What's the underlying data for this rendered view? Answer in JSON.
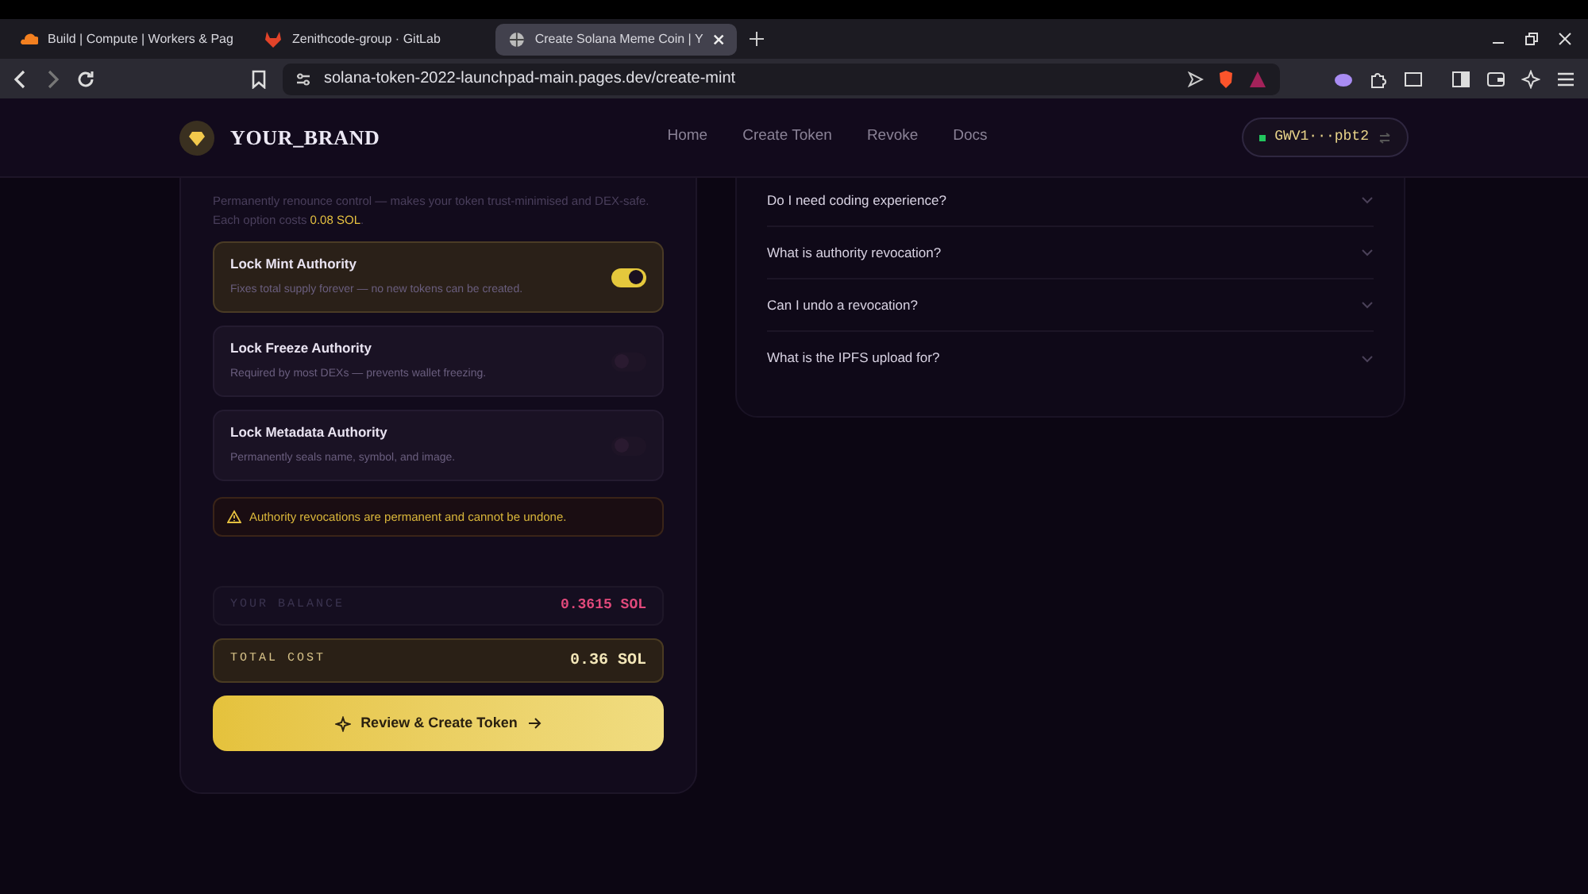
{
  "browser": {
    "tabs": [
      {
        "title": "Build | Compute | Workers & Pag",
        "selected": false,
        "kind": "cloud"
      },
      {
        "title": "Zenithcode-group · GitLab",
        "selected": false,
        "kind": "fox"
      },
      {
        "title": "Create Solana Meme Coin | Y",
        "selected": true,
        "kind": "globe"
      }
    ],
    "url": "solana-token-2022-launchpad-main.pages.dev/create-mint"
  },
  "header": {
    "brand": "YOUR_BRAND",
    "nav": [
      "Home",
      "Create Token",
      "Revoke",
      "Docs"
    ],
    "wallet": "GWV1···pbt2"
  },
  "lock": {
    "description": "Permanently renounce control — makes your token trust-minimised and DEX-safe. Each option costs **0.08 SOL**.",
    "options": [
      {
        "title": "Lock Mint Authority",
        "subtitle": "Fixes total supply forever — no new tokens can be created.",
        "on": true
      },
      {
        "title": "Lock Freeze Authority",
        "subtitle": "Required by most DEXs — prevents wallet freezing.",
        "on": false
      },
      {
        "title": "Lock Metadata Authority",
        "subtitle": "Permanently seals name, symbol, and image.",
        "on": false
      }
    ],
    "warning": "Authority revocations are permanent and cannot be undone.",
    "balance_label": "YOUR BALANCE",
    "balance": "0.3615 SOL",
    "cost_label": "TOTAL COST",
    "cost": "0.36 SOL",
    "submit": "Review & Create Token"
  },
  "faq": [
    {
      "question": "Do I need coding experience?",
      "expanded": false
    },
    {
      "question": "What is authority revocation?",
      "expanded": false
    },
    {
      "question": "Can I undo a revocation?",
      "expanded": false
    },
    {
      "question": "What is the IPFS upload for?",
      "expanded": false
    }
  ]
}
